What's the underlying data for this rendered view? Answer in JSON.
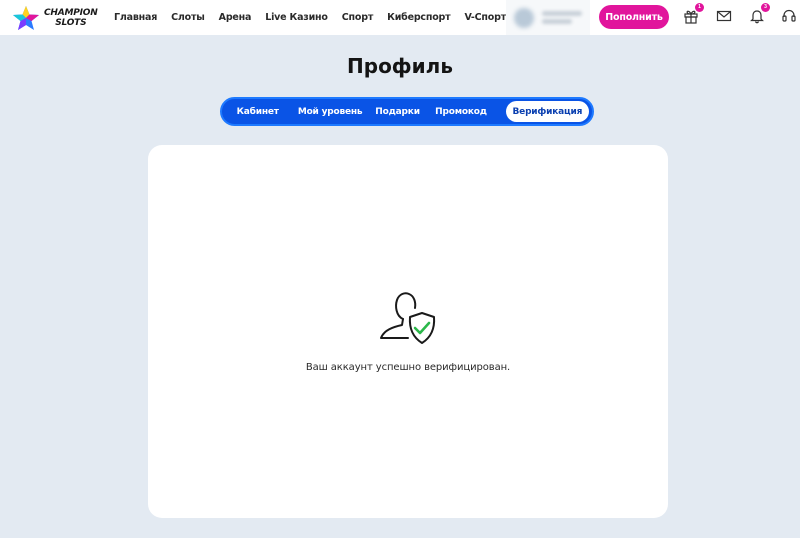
{
  "brand": {
    "line1": "CHAMPION",
    "line2": "SLOTS"
  },
  "nav": [
    "Главная",
    "Слоты",
    "Арена",
    "Live Казино",
    "Спорт",
    "Киберспорт",
    "V-Спорт"
  ],
  "header": {
    "deposit_label": "Пополнить",
    "gift_badge": "1",
    "bell_badge": "3",
    "icons": [
      "gift-icon",
      "mail-icon",
      "bell-icon",
      "support-headset-icon"
    ]
  },
  "page": {
    "title": "Профиль"
  },
  "tabs": [
    "Кабинет",
    "Мой уровень",
    "Подарки",
    "Промокод",
    "Верификация"
  ],
  "active_tab": "Верификация",
  "verification": {
    "message": "Ваш аккаунт успешно верифицирован."
  },
  "colors": {
    "accent_pink": "#e1159c",
    "tabs_blue": "#0a54e6",
    "check_green": "#2bb84a",
    "page_bg": "#e3eaf2"
  }
}
